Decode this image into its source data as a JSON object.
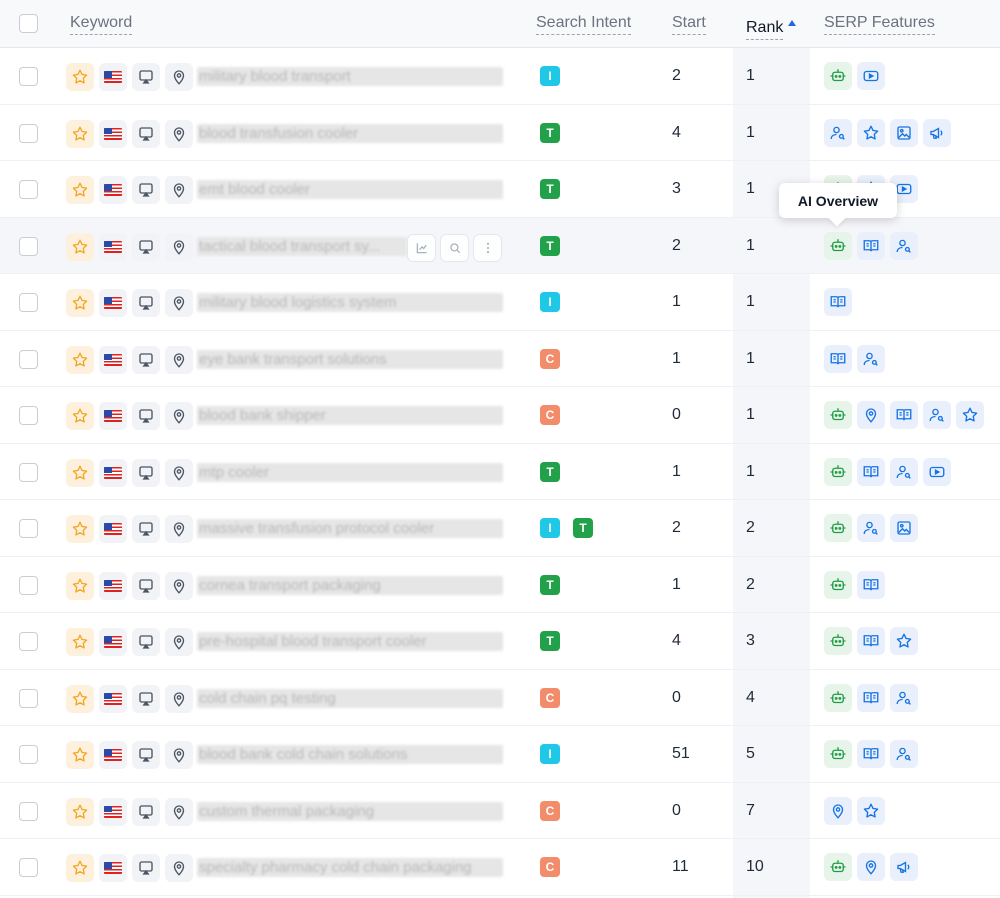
{
  "header": {
    "keyword": "Keyword",
    "search_intent": "Search Intent",
    "start": "Start",
    "rank": "Rank",
    "serp_features": "SERP Features"
  },
  "tooltip": "AI Overview",
  "colors": {
    "accent": "#2563eb",
    "intent_I": "#1ec8e6",
    "intent_T": "#23a14a",
    "intent_C": "#f28c6b",
    "star": "#f5a524"
  },
  "rows": [
    {
      "keyword": "military blood transport",
      "intents": [
        "I"
      ],
      "start": "2",
      "rank": "1",
      "features": [
        "ai-overview",
        "video"
      ]
    },
    {
      "keyword": "blood transfusion cooler",
      "intents": [
        "T"
      ],
      "start": "4",
      "rank": "1",
      "features": [
        "people-also-ask",
        "reviews",
        "image",
        "ads"
      ]
    },
    {
      "keyword": "emt blood cooler",
      "intents": [
        "T"
      ],
      "start": "3",
      "rank": "1",
      "features": [
        "ai-overview",
        "reviews",
        "video"
      ]
    },
    {
      "keyword": "tactical blood transport sy...",
      "intents": [
        "T"
      ],
      "start": "2",
      "rank": "1",
      "features": [
        "ai-overview",
        "knowledge-panel",
        "people-also-ask"
      ],
      "hover": true
    },
    {
      "keyword": "military blood logistics system",
      "intents": [
        "I"
      ],
      "start": "1",
      "rank": "1",
      "features": [
        "knowledge-panel"
      ]
    },
    {
      "keyword": "eye bank transport solutions",
      "intents": [
        "C"
      ],
      "start": "1",
      "rank": "1",
      "features": [
        "knowledge-panel",
        "people-also-ask"
      ]
    },
    {
      "keyword": "blood bank shipper",
      "intents": [
        "C"
      ],
      "start": "0",
      "rank": "1",
      "features": [
        "ai-overview",
        "local-pack",
        "knowledge-panel",
        "people-also-ask",
        "reviews"
      ]
    },
    {
      "keyword": "mtp cooler",
      "intents": [
        "T"
      ],
      "start": "1",
      "rank": "1",
      "features": [
        "ai-overview",
        "knowledge-panel",
        "people-also-ask",
        "video"
      ]
    },
    {
      "keyword": "massive transfusion protocol cooler",
      "intents": [
        "I",
        "T"
      ],
      "start": "2",
      "rank": "2",
      "features": [
        "ai-overview",
        "people-also-ask",
        "image"
      ]
    },
    {
      "keyword": "cornea transport packaging",
      "intents": [
        "T"
      ],
      "start": "1",
      "rank": "2",
      "features": [
        "ai-overview",
        "knowledge-panel"
      ]
    },
    {
      "keyword": "pre-hospital blood transport cooler",
      "intents": [
        "T"
      ],
      "start": "4",
      "rank": "3",
      "features": [
        "ai-overview",
        "knowledge-panel",
        "reviews"
      ]
    },
    {
      "keyword": "cold chain pq testing",
      "intents": [
        "C"
      ],
      "start": "0",
      "rank": "4",
      "features": [
        "ai-overview",
        "knowledge-panel",
        "people-also-ask"
      ]
    },
    {
      "keyword": "blood bank cold chain solutions",
      "intents": [
        "I"
      ],
      "start": "51",
      "rank": "5",
      "features": [
        "ai-overview",
        "knowledge-panel",
        "people-also-ask"
      ]
    },
    {
      "keyword": "custom thermal packaging",
      "intents": [
        "C"
      ],
      "start": "0",
      "rank": "7",
      "features": [
        "local-pack",
        "reviews"
      ]
    },
    {
      "keyword": "specialty pharmacy cold chain packaging",
      "intents": [
        "C"
      ],
      "start": "11",
      "rank": "10",
      "features": [
        "ai-overview",
        "local-pack",
        "ads"
      ]
    }
  ]
}
